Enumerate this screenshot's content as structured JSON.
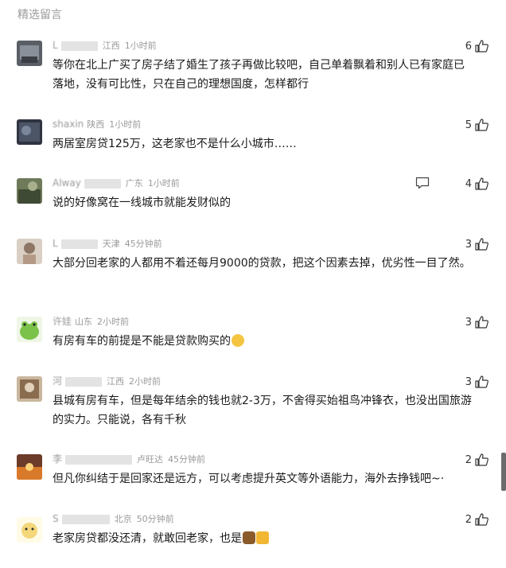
{
  "section": {
    "title": "精选留言"
  },
  "comments": [
    {
      "name": "L",
      "location": "江西",
      "time": "1小时前",
      "likes": "6",
      "text": "等你在北上广买了房子结了婚生了孩子再做比较吧，自己单着飘着和别人已有家庭已落地，没有可比性，只在自己的理想国度，怎样都行"
    },
    {
      "name": "shaxin",
      "location": "陕西",
      "time": "1小时前",
      "likes": "5",
      "text": "两居室房贷125万，这老家也不是什么小城市……"
    },
    {
      "name": "Alway",
      "location": "广东",
      "time": "1小时前",
      "likes": "4",
      "text": "说的好像窝在一线城市就能发财似的"
    },
    {
      "name": "L",
      "location": "天津",
      "time": "45分钟前",
      "likes": "3",
      "text": "大部分回老家的人都用不着还每月9000的贷款，把这个因素去掉，优劣性一目了然。"
    },
    {
      "name": "许娃",
      "location": "山东",
      "time": "2小时前",
      "likes": "3",
      "text": "有房有车的前提是不能是贷款购买的"
    },
    {
      "name": "河",
      "location": "江西",
      "time": "2小时前",
      "likes": "3",
      "text": "县城有房有车，但是每年结余的钱也就2-3万，不舍得买始祖鸟冲锋衣，也没出国旅游的实力。只能说，各有千秋"
    },
    {
      "name": "李",
      "location": "卢旺达",
      "time": "45分钟前",
      "likes": "2",
      "text": "但凡你纠结于是回家还是远方，可以考虑提升英文等外语能力，海外去挣钱吧~·"
    },
    {
      "name": "S",
      "location": "北京",
      "time": "50分钟前",
      "likes": "2",
      "text": "老家房贷都没还清，就敢回老家，也是"
    }
  ],
  "colors": {
    "meta": "#999999",
    "text": "#1a1a1a",
    "title": "#9a9a9a"
  },
  "icons": {
    "like": "thumbs-up-icon",
    "reply": "comment-icon"
  }
}
